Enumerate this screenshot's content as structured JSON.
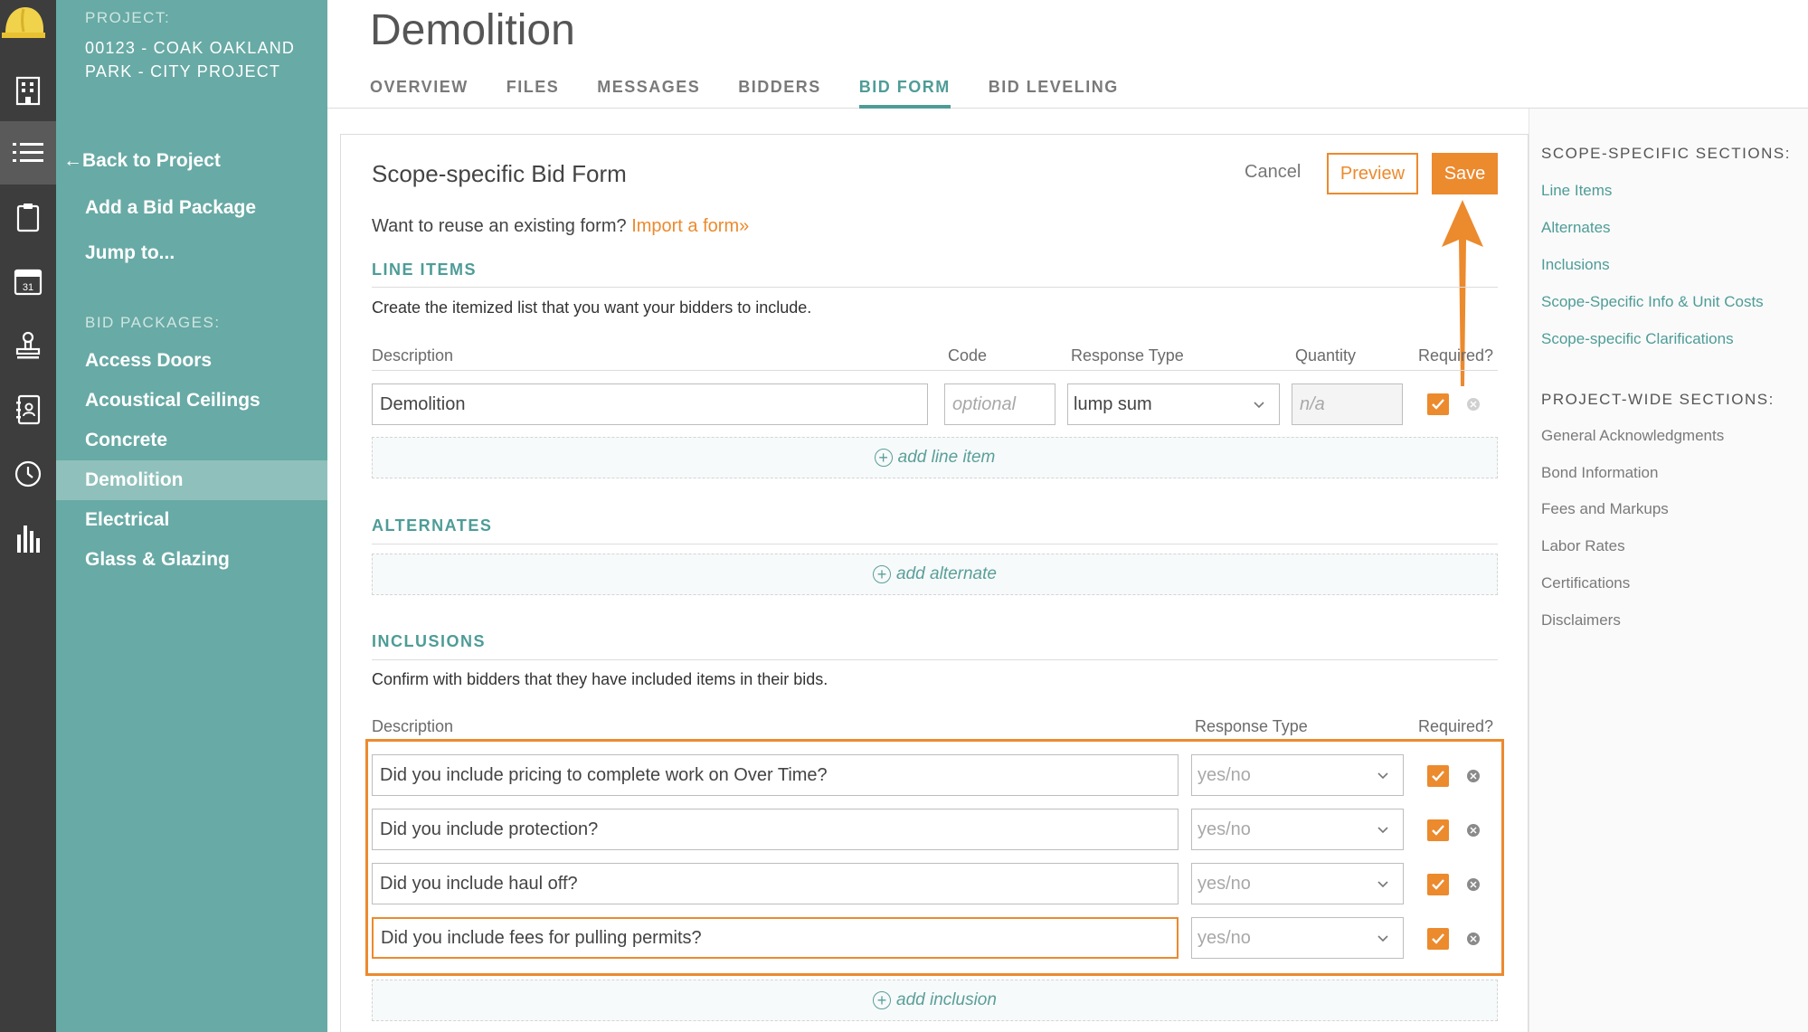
{
  "project": {
    "label": "PROJECT:",
    "name": "00123 - COAK OAKLAND PARK - CITY PROJECT"
  },
  "sidebar": {
    "back": "Back to Project",
    "add_bid_package": "Add a Bid Package",
    "jump_to": "Jump to...",
    "bid_packages_label": "BID PACKAGES:",
    "packages": [
      {
        "label": "Access Doors"
      },
      {
        "label": "Acoustical Ceilings"
      },
      {
        "label": "Concrete"
      },
      {
        "label": "Demolition"
      },
      {
        "label": "Electrical"
      },
      {
        "label": "Glass & Glazing"
      }
    ]
  },
  "rail": {
    "icons": [
      "hardhat-logo-icon",
      "building-icon",
      "list-icon",
      "clipboard-icon",
      "calendar-icon",
      "stamp-icon",
      "contacts-book-icon",
      "clock-icon",
      "bar-chart-icon"
    ],
    "calendar_day": "31"
  },
  "header": {
    "title": "Demolition",
    "tabs": [
      {
        "label": "OVERVIEW"
      },
      {
        "label": "FILES"
      },
      {
        "label": "MESSAGES"
      },
      {
        "label": "BIDDERS"
      },
      {
        "label": "BID FORM"
      },
      {
        "label": "BID LEVELING"
      }
    ],
    "active_tab": "BID FORM"
  },
  "form": {
    "title": "Scope-specific Bid Form",
    "cancel": "Cancel",
    "preview": "Preview",
    "save": "Save",
    "reuse_text": "Want to reuse an existing form?",
    "import_link": "Import a form»",
    "line_items": {
      "heading": "LINE ITEMS",
      "description": "Create the itemized list that you want your bidders to include.",
      "col_description": "Description",
      "col_code": "Code",
      "col_response": "Response Type",
      "col_quantity": "Quantity",
      "col_required": "Required?",
      "row": {
        "description": "Demolition",
        "code_placeholder": "optional",
        "response": "lump sum",
        "quantity_placeholder": "n/a"
      },
      "add": "add line item"
    },
    "alternates": {
      "heading": "ALTERNATES",
      "add": "add alternate"
    },
    "inclusions": {
      "heading": "INCLUSIONS",
      "description": "Confirm with bidders that they have included items in their bids.",
      "col_description": "Description",
      "col_response": "Response Type",
      "col_required": "Required?",
      "rows": [
        {
          "description": "Did you include pricing to complete work on Over Time?",
          "response": "yes/no"
        },
        {
          "description": "Did you include protection?",
          "response": "yes/no"
        },
        {
          "description": "Did you include haul off?",
          "response": "yes/no"
        },
        {
          "description": "Did you include fees for pulling permits?",
          "response": "yes/no"
        }
      ],
      "add": "add inclusion"
    }
  },
  "right_panel": {
    "scope_heading": "SCOPE-SPECIFIC SECTIONS:",
    "scope_links": [
      "Line Items",
      "Alternates",
      "Inclusions",
      "Scope-Specific Info & Unit Costs",
      "Scope-specific Clarifications"
    ],
    "project_heading": "PROJECT-WIDE SECTIONS:",
    "project_links": [
      "General Acknowledgments",
      "Bond Information",
      "Fees and Markups",
      "Labor Rates",
      "Certifications",
      "Disclaimers"
    ]
  },
  "colors": {
    "accent_orange": "#ec8a2e",
    "teal": "#4e9c97",
    "sidebar_teal": "#68aaa5",
    "rail_dark": "#3d3d3d"
  }
}
